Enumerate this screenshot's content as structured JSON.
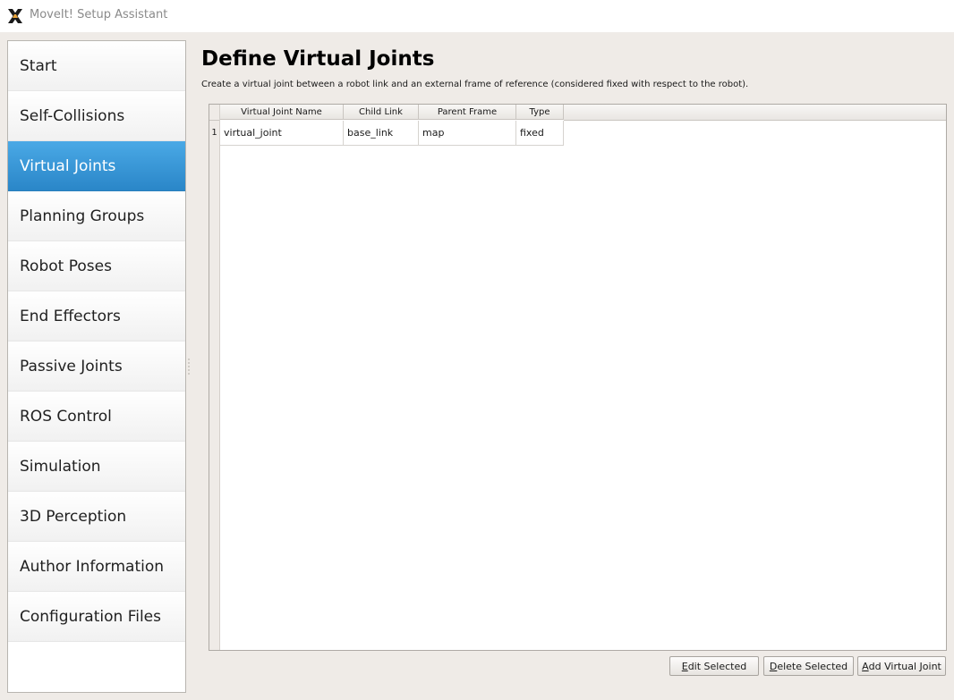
{
  "window": {
    "title": "MoveIt! Setup Assistant",
    "icon": "x-logo-icon"
  },
  "sidebar": {
    "active_index": 2,
    "items": [
      {
        "label": "Start"
      },
      {
        "label": "Self-Collisions"
      },
      {
        "label": "Virtual Joints"
      },
      {
        "label": "Planning Groups"
      },
      {
        "label": "Robot Poses"
      },
      {
        "label": "End Effectors"
      },
      {
        "label": "Passive Joints"
      },
      {
        "label": "ROS Control"
      },
      {
        "label": "Simulation"
      },
      {
        "label": "3D Perception"
      },
      {
        "label": "Author Information"
      },
      {
        "label": "Configuration Files"
      }
    ]
  },
  "page": {
    "title": "Define Virtual Joints",
    "description": "Create a virtual joint between a robot link and an external frame of reference (considered fixed with respect to the robot)."
  },
  "table": {
    "columns": [
      "Virtual Joint Name",
      "Child Link",
      "Parent Frame",
      "Type"
    ],
    "rows": [
      {
        "num": "1",
        "cells": [
          "virtual_joint",
          "base_link",
          "map",
          "fixed"
        ]
      }
    ]
  },
  "buttons": {
    "edit": {
      "mnemonic": "E",
      "rest": "dit Selected"
    },
    "delete": {
      "mnemonic": "D",
      "rest": "elete Selected"
    },
    "add": {
      "mnemonic": "A",
      "rest": "dd Virtual Joint"
    }
  },
  "colors": {
    "active_nav": "#2f8ed3",
    "background": "#efebe7"
  }
}
